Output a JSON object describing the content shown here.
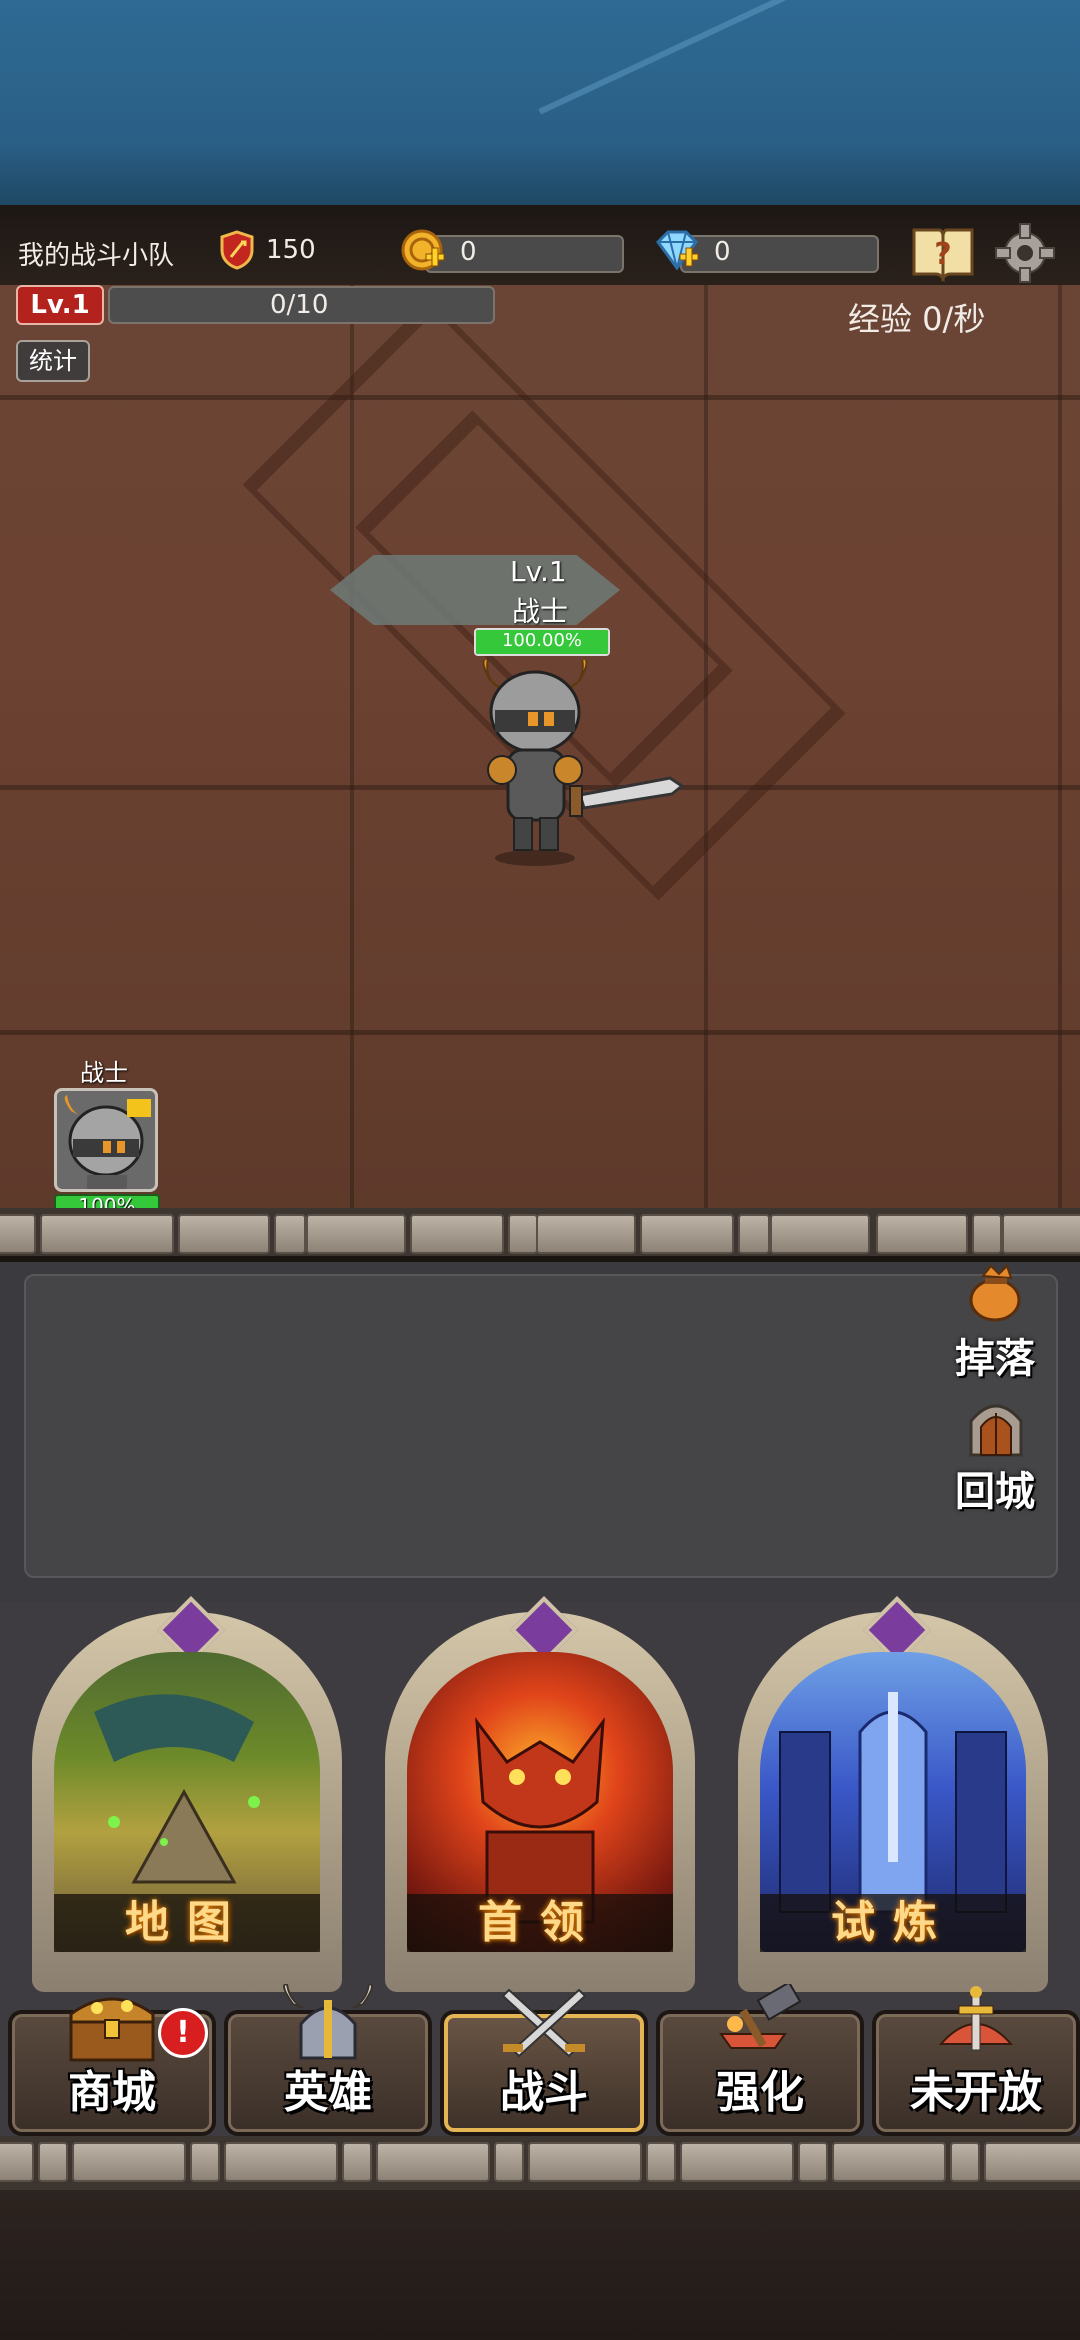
{
  "header": {
    "team_name": "我的战斗小队",
    "power": "150",
    "gold": "0",
    "diamonds": "0",
    "level_badge": "Lv.1",
    "exp_progress": "0/10",
    "exp_rate": "经验 0/秒",
    "stats_button": "统计"
  },
  "battle": {
    "hero_level": "Lv.1",
    "hero_name": "战士",
    "hero_hp": "100.00%",
    "hero_hp_fraction": 1.0
  },
  "party": {
    "member_name": "战士",
    "member_hp": "100%"
  },
  "side_buttons": {
    "drops": "掉落",
    "return_city": "回城"
  },
  "modes": [
    {
      "label": "地图"
    },
    {
      "label": "首领"
    },
    {
      "label": "试炼"
    }
  ],
  "nav": [
    {
      "label": "商城",
      "alert": "!"
    },
    {
      "label": "英雄"
    },
    {
      "label": "战斗"
    },
    {
      "label": "强化"
    },
    {
      "label": "未开放"
    }
  ],
  "colors": {
    "hp_green": "#35c83a",
    "level_red": "#b4221d",
    "gold_text": "#ffd98a"
  }
}
